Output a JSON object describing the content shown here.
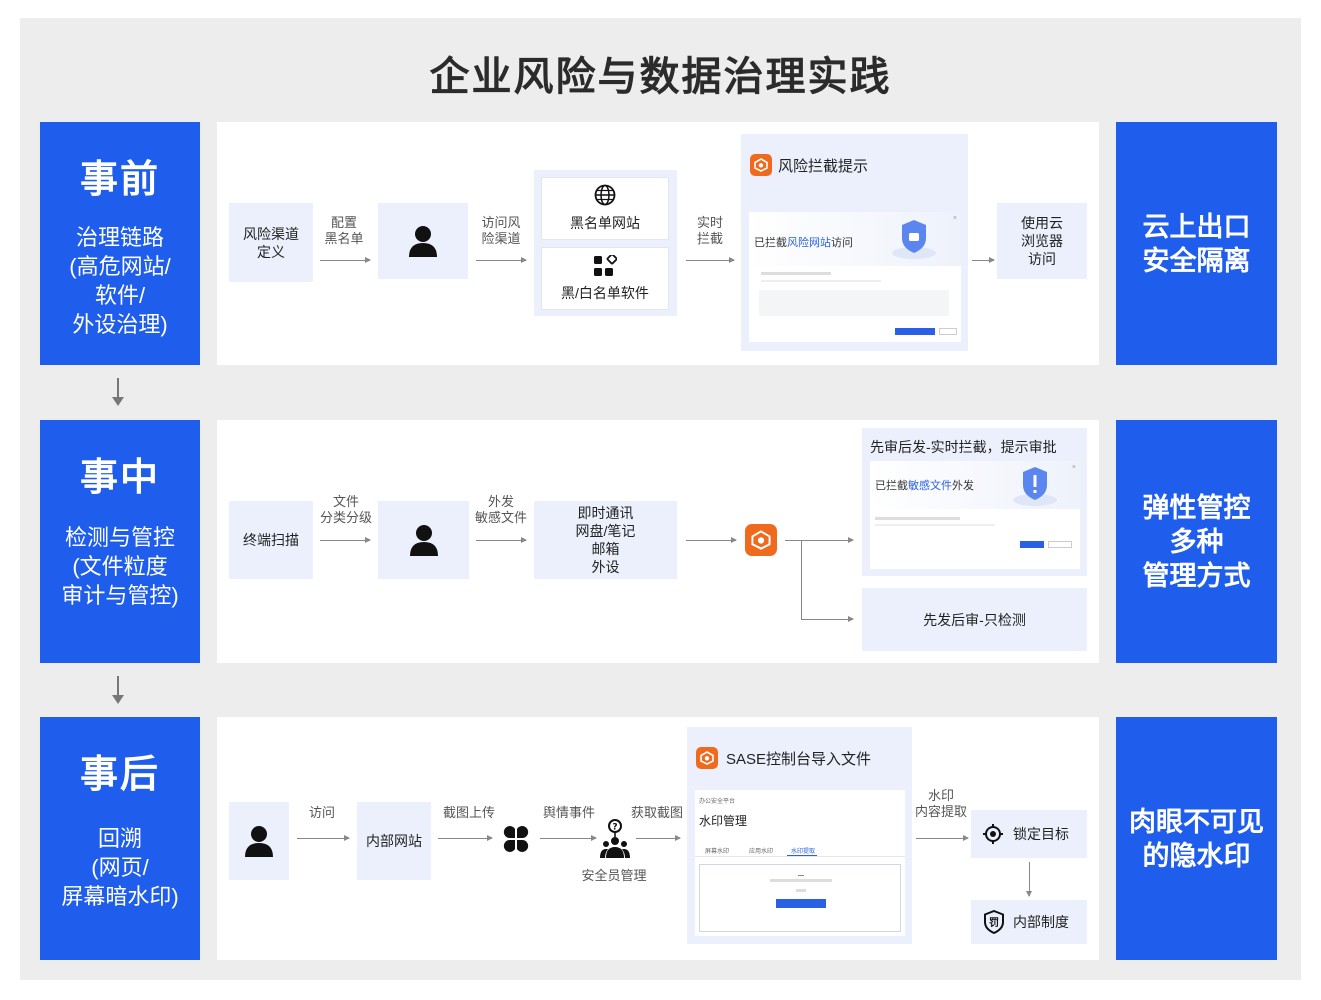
{
  "title": "企业风险与数据治理实践",
  "stages": [
    {
      "big": "事前",
      "sub": "治理链路\n(高危网站/\n软件/\n外设治理)",
      "right": "云上出口\n安全隔离"
    },
    {
      "big": "事中",
      "sub": "检测与管控\n(文件粒度\n审计与管控)",
      "right": "弹性管控\n多种\n管理方式"
    },
    {
      "big": "事后",
      "sub": "回溯\n(网页/\n屏幕暗水印)",
      "right": "肉眼不可见\n的隐水印"
    }
  ],
  "row1": {
    "node_channel": "风险渠道\n定义",
    "label_config": "配置\n黑名单",
    "label_access": "访问风\n险渠道",
    "blacklist_site": "黑名单网站",
    "bw_software": "黑/白名单软件",
    "label_realtime": "实时\n拦截",
    "popup_title": "风险拦截提示",
    "popup_blocked_prefix": "已拦截",
    "popup_blocked_highlight": "风险网站",
    "popup_blocked_suffix": "访问",
    "cloud_browser": "使用云\n浏览器\n访问"
  },
  "row2": {
    "node_scan": "终端扫描",
    "label_classify": "文件\n分类分级",
    "label_send": "外发\n敏感文件",
    "channels": "即时通讯\n网盘/笔记\n邮箱\n外设",
    "approve_title": "先审后发-实时拦截，提示审批",
    "approve_blocked_prefix": "已拦截",
    "approve_blocked_highlight": "敏感文件",
    "approve_blocked_suffix": "外发",
    "detect_only": "先发后审-只检测"
  },
  "row3": {
    "label_visit": "访问",
    "node_internal": "内部网站",
    "label_screenshot": "截图上传",
    "label_event": "舆情事件",
    "label_get": "获取截图",
    "security_admin": "安全员管理",
    "sase_title": "SASE控制台导入文件",
    "sase_breadcrumb": "办公安全平台",
    "sase_heading": "水印管理",
    "sase_tabs": [
      "屏幕水印",
      "应用水印",
      "水印提取"
    ],
    "label_extract": "水印\n内容提取",
    "lock_target": "锁定目标",
    "internal_policy": "内部制度"
  },
  "colors": {
    "brand_blue": "#1f5ded",
    "node_bg": "#ebf0fc",
    "accent_orange": "#f06a1e"
  }
}
